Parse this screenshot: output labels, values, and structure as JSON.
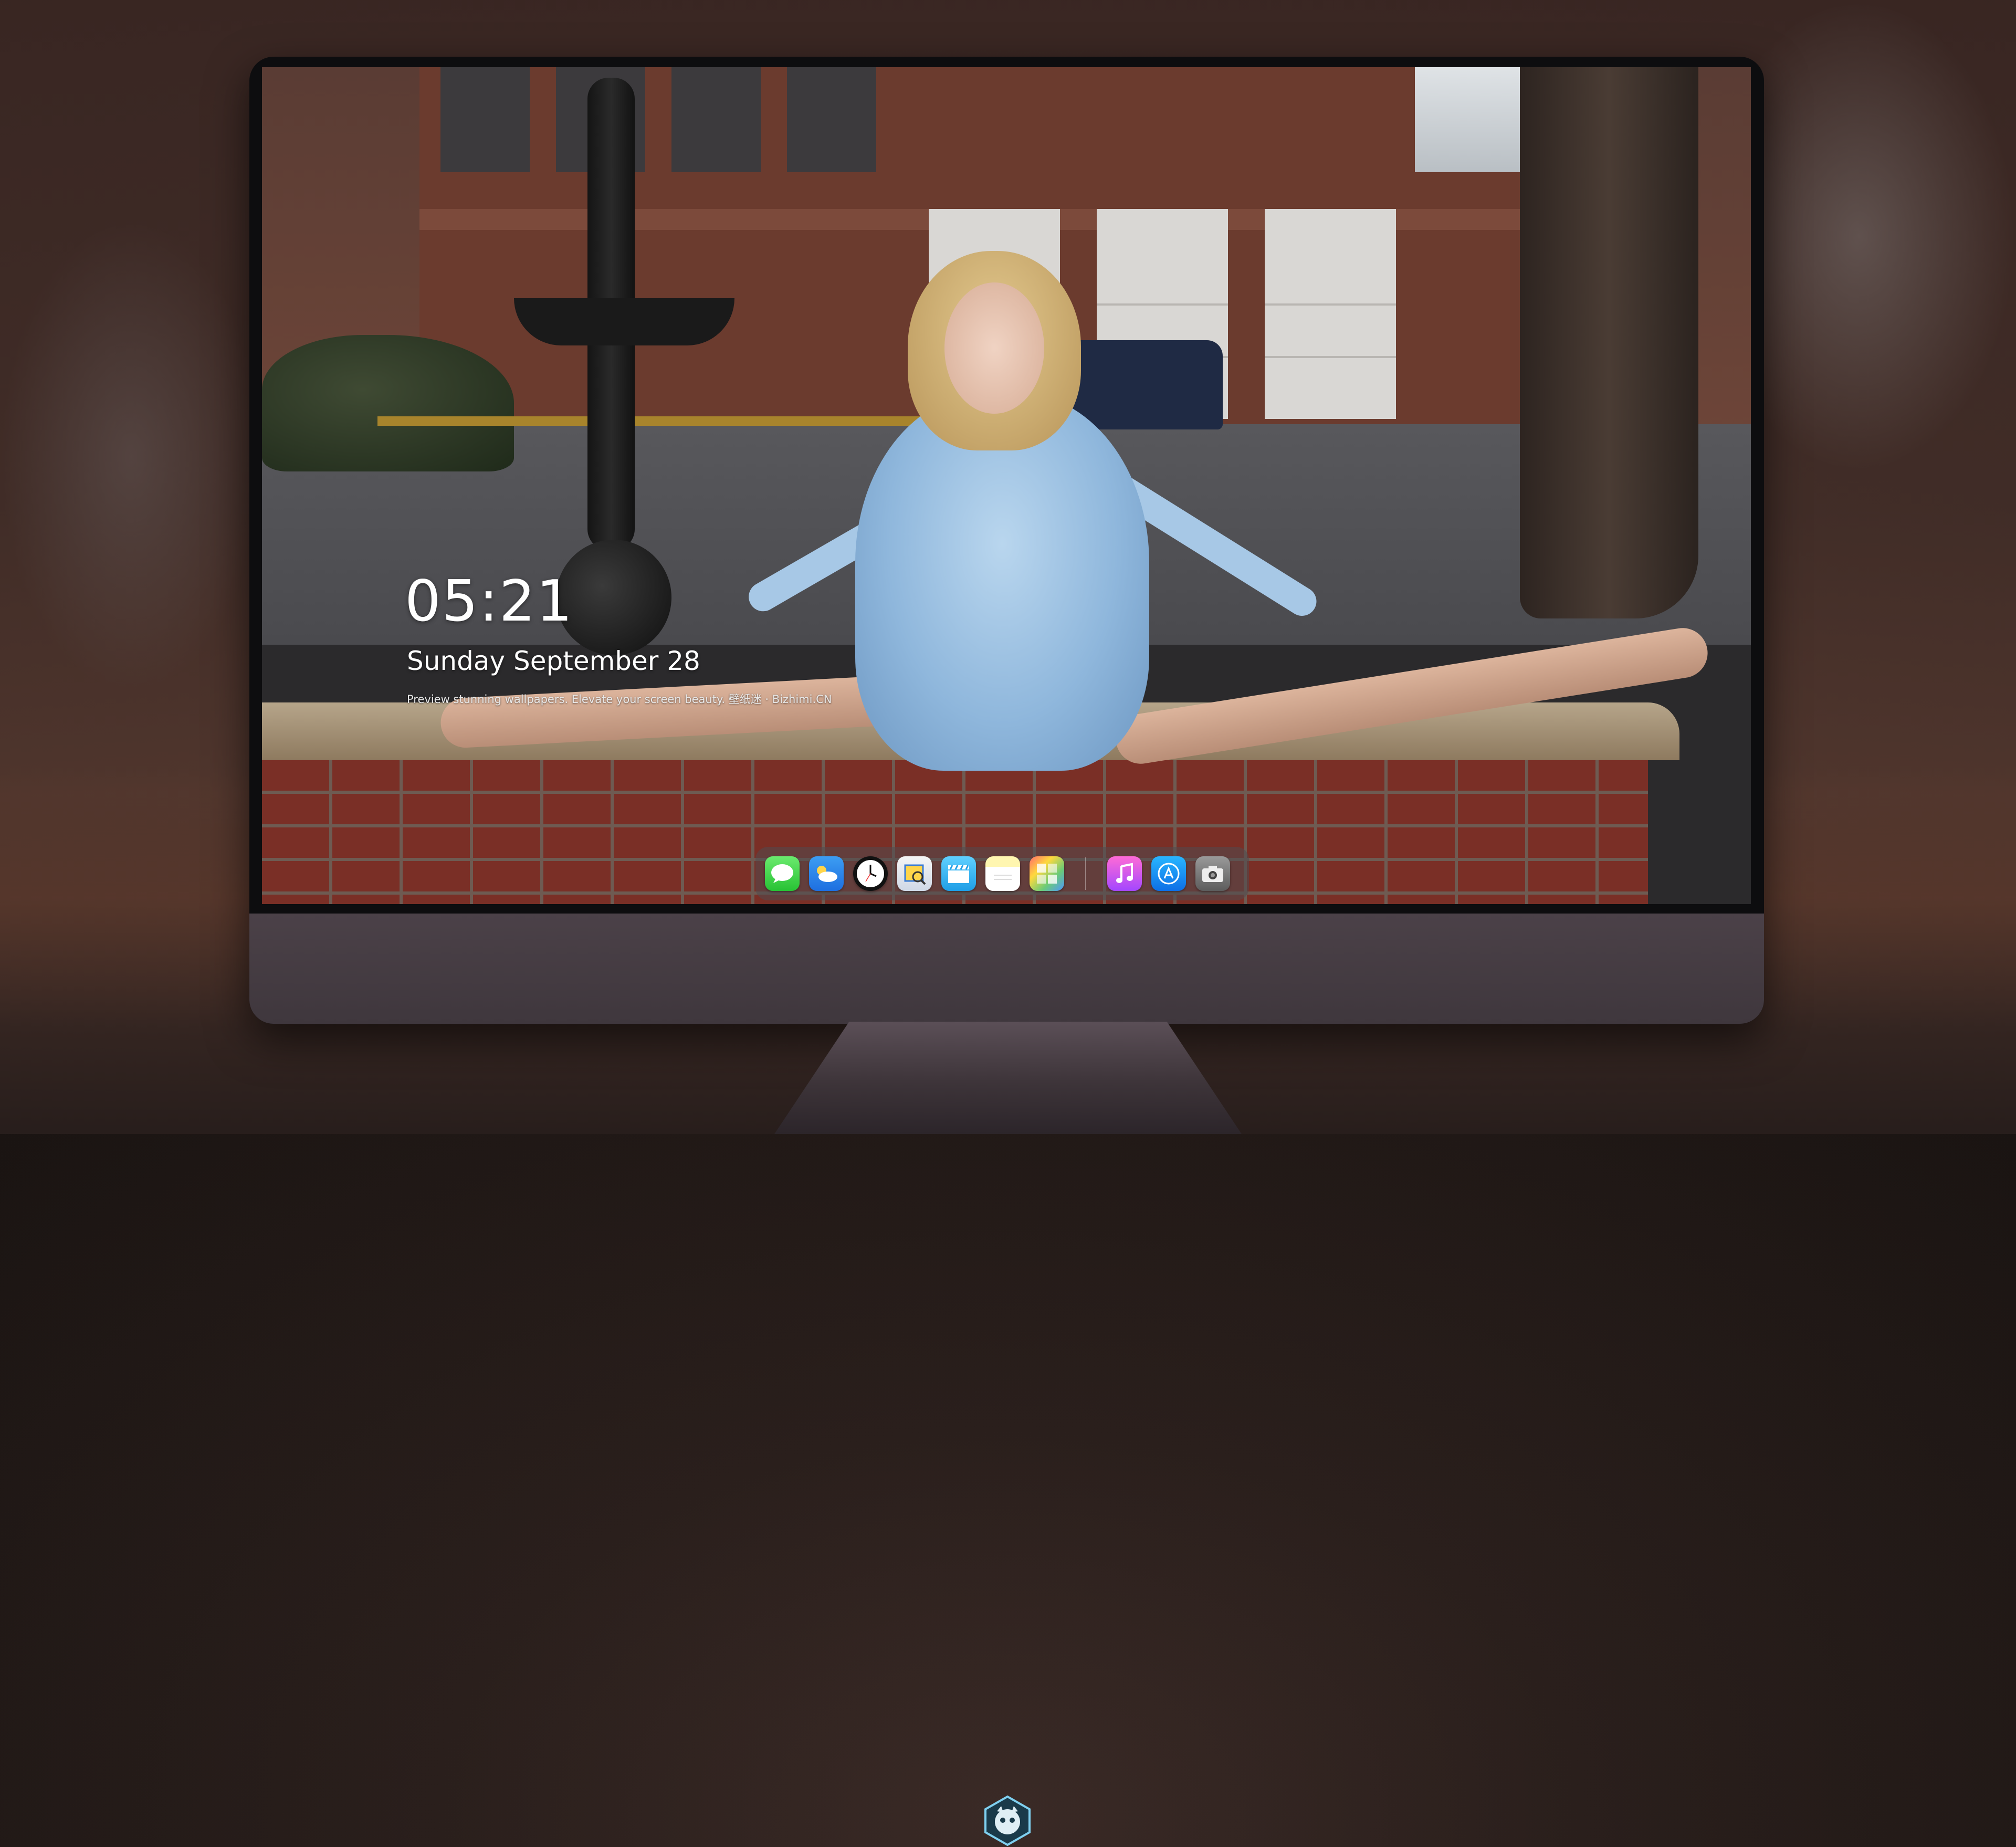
{
  "lockscreen": {
    "time": "05:21",
    "date": "Sunday September  28",
    "tagline": "Preview stunning wallpapers. Elevate your screen beauty. 壁纸迷 · Bizhimi.CN"
  },
  "dock": {
    "apps": [
      {
        "name": "Messages",
        "icon": "messages-icon"
      },
      {
        "name": "Weather",
        "icon": "weather-icon"
      },
      {
        "name": "Clock",
        "icon": "clock-icon"
      },
      {
        "name": "Preview",
        "icon": "preview-icon"
      },
      {
        "name": "Clips",
        "icon": "clapper-icon"
      },
      {
        "name": "Notes",
        "icon": "notes-icon"
      },
      {
        "name": "Photo Booth",
        "icon": "photobooth-icon"
      },
      {
        "name": "Music",
        "icon": "music-icon"
      },
      {
        "name": "App Store",
        "icon": "appstore-icon"
      },
      {
        "name": "Camera",
        "icon": "camera-icon"
      }
    ]
  },
  "colors": {
    "text": "#ffffff",
    "monitor_chin": "#463c42",
    "dress": "#9dc2e4"
  }
}
